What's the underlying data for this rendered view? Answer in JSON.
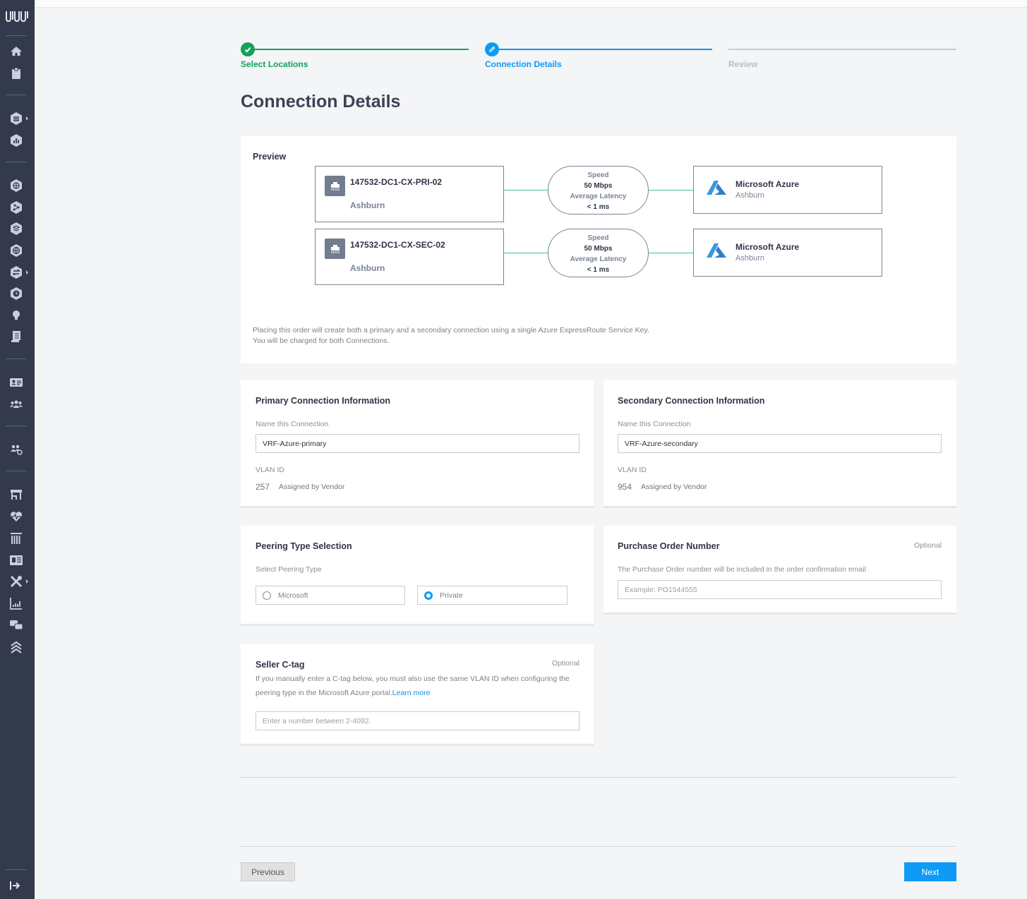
{
  "sidebar": {
    "items": [
      {
        "name": "home-icon"
      },
      {
        "name": "clipboard-icon"
      },
      {
        "name": "layers-hex-icon",
        "has_submenu": true
      },
      {
        "name": "chart-hex-icon"
      },
      {
        "name": "network-hex-icon"
      },
      {
        "name": "connections-hex-icon"
      },
      {
        "name": "stack-hex-icon"
      },
      {
        "name": "globe-hex-icon"
      },
      {
        "name": "exchange-hex-icon",
        "has_submenu": true
      },
      {
        "name": "clock-hex-icon"
      },
      {
        "name": "lightbulb-icon"
      },
      {
        "name": "document-icon"
      },
      {
        "name": "id-card-icon"
      },
      {
        "name": "users-icon"
      },
      {
        "name": "users-settings-icon"
      },
      {
        "name": "store-icon"
      },
      {
        "name": "heart-pulse-icon"
      },
      {
        "name": "pillars-icon"
      },
      {
        "name": "newspaper-icon"
      },
      {
        "name": "tools-icon",
        "has_submenu": true
      },
      {
        "name": "bar-chart-icon"
      },
      {
        "name": "chat-icon"
      },
      {
        "name": "chevrons-up-icon"
      }
    ],
    "collapse_icon": "expand-sidebar-icon"
  },
  "stepper": {
    "steps": [
      {
        "label": "Select Locations",
        "state": "complete",
        "color": "#14a15a"
      },
      {
        "label": "Connection Details",
        "state": "active",
        "color": "#0d9bf5"
      },
      {
        "label": "Review",
        "state": "pending",
        "color": "#b7bcc6"
      }
    ]
  },
  "page_title": "Connection Details",
  "preview": {
    "title": "Preview",
    "connections": [
      {
        "port_name": "147532-DC1-CX-PRI-02",
        "port_location": "Ashburn",
        "speed_label": "Speed",
        "speed_value": "50 Mbps",
        "latency_label": "Average Latency",
        "latency_value": "< 1 ms",
        "provider_name": "Microsoft Azure",
        "provider_location": "Ashburn"
      },
      {
        "port_name": "147532-DC1-CX-SEC-02",
        "port_location": "Ashburn",
        "speed_label": "Speed",
        "speed_value": "50 Mbps",
        "latency_label": "Average Latency",
        "latency_value": "< 1 ms",
        "provider_name": "Microsoft Azure",
        "provider_location": "Ashburn"
      }
    ],
    "note_line1": "Placing this order will create both a primary and a secondary connection using a single Azure ExpressRoute Service Key.",
    "note_line2": "You will be charged for both Connections."
  },
  "primary": {
    "title": "Primary Connection Information",
    "name_label": "Name this Connection",
    "name_value": "VRF-Azure-primary",
    "vlan_label": "VLAN ID",
    "vlan_value": "257",
    "vlan_note": "Assigned by Vendor"
  },
  "secondary": {
    "title": "Secondary Connection Information",
    "name_label": "Name this Connection",
    "name_value": "VRF-Azure-secondary",
    "vlan_label": "VLAN ID",
    "vlan_value": "954",
    "vlan_note": "Assigned by Vendor"
  },
  "peering": {
    "title": "Peering Type Selection",
    "label": "Select Peering Type",
    "options": [
      {
        "label": "Microsoft",
        "selected": false
      },
      {
        "label": "Private",
        "selected": true
      }
    ]
  },
  "purchase_order": {
    "title": "Purchase Order Number",
    "optional": "Optional",
    "description": "The Purchase Order number will be included in the order confirmation email",
    "placeholder": "Example: PO1544555",
    "value": ""
  },
  "seller_ctag": {
    "title": "Seller C-tag",
    "optional": "Optional",
    "description": "If you manually enter a C-tag below, you must also use the same VLAN ID when configuring the peering type in the Microsoft Azure portal.",
    "link_text": "Learn more",
    "placeholder": "Enter a number between 2-4092.",
    "value": ""
  },
  "footer": {
    "previous_label": "Previous",
    "next_label": "Next"
  }
}
